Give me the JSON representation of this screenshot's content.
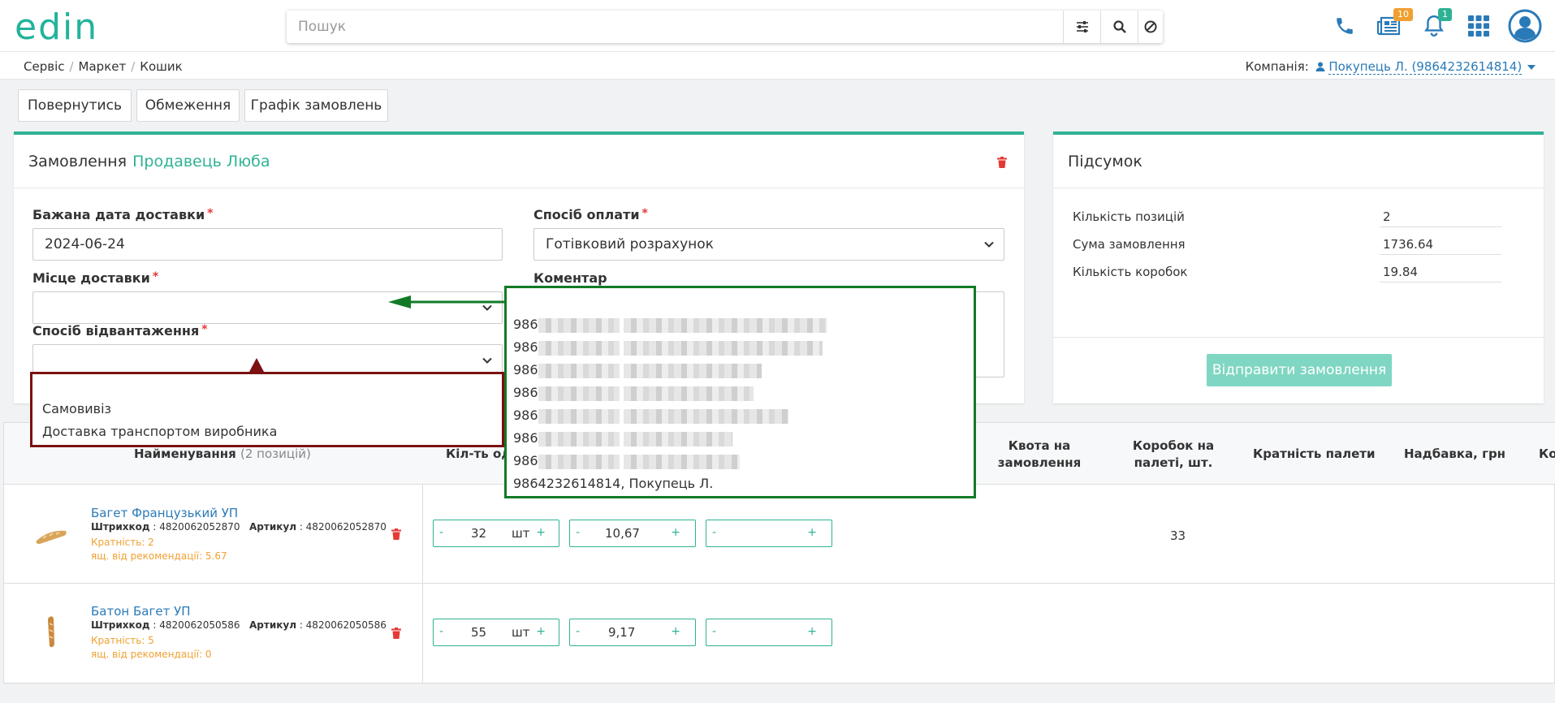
{
  "header": {
    "logo_text": "edin",
    "search_placeholder": "Пошук",
    "news_badge": "10",
    "notifications_badge": "1"
  },
  "breadcrumb": [
    "Сервіс",
    "Маркет",
    "Кошик"
  ],
  "company": {
    "label": "Компанія:",
    "value": "Покупець Л. (9864232614814)"
  },
  "toolbar": {
    "back": "Повернутись",
    "limits": "Обмеження",
    "schedule": "Графік замовлень"
  },
  "order": {
    "title": "Замовлення",
    "seller": "Продавець Люба",
    "delivery_date_label": "Бажана дата доставки",
    "delivery_date_value": "2024-06-24",
    "payment_label": "Спосіб оплати",
    "payment_value": "Готівковий розрахунок",
    "place_label": "Місце доставки",
    "place_value": "",
    "shipment_label": "Спосіб відвантаження",
    "shipment_value": "",
    "comment_label": "Коментар"
  },
  "summary": {
    "title": "Підсумок",
    "rows": [
      {
        "label": "Кількість позицій",
        "value": "2"
      },
      {
        "label": "Сума замовлення",
        "value": "1736.64"
      },
      {
        "label": "Кількість коробок",
        "value": "19.84"
      }
    ],
    "send_button": "Відправити замовлення"
  },
  "shipment_options": [
    "Самовивіз",
    "Доставка транспортом виробника"
  ],
  "delivery_places": {
    "prefix_visible": [
      "986",
      "986",
      "986",
      "986",
      "986",
      "986",
      "986"
    ],
    "last_item": "9864232614814, Покупець Л."
  },
  "table": {
    "headers": {
      "name": "Найменування",
      "name_count": "(2 позицій)",
      "qty": "Кіл-ть оди",
      "quota": "Квота на замовлення",
      "boxes_per_pallet": "Коробок на палеті, шт.",
      "pallet_multiplicity": "Кратність палети",
      "surcharge": "Надбавка, грн",
      "code": "Ко"
    },
    "rows": [
      {
        "name": "Багет Французький УП",
        "barcode_label": "Штрихкод",
        "barcode": "4820062052870",
        "article_label": "Артикул",
        "article": "4820062052870",
        "multiplicity": "Кратність:  2",
        "recommend": "ящ. від рекомендації:  5.67",
        "qty": "32",
        "unit": "шт",
        "price": "10,67",
        "third": "",
        "boxes_per_pallet": "33"
      },
      {
        "name": "Батон Багет УП",
        "barcode_label": "Штрихкод",
        "barcode": "4820062050586",
        "article_label": "Артикул",
        "article": "4820062050586",
        "multiplicity": "Кратність:  5",
        "recommend": "ящ. від рекомендації:  0",
        "qty": "55",
        "unit": "шт",
        "price": "9,17",
        "third": "",
        "boxes_per_pallet": ""
      }
    ]
  },
  "colors": {
    "accent": "#2fb294",
    "link": "#2a7ab8",
    "danger": "#e53935",
    "annot_red": "#7b1111",
    "annot_green": "#127a27"
  }
}
